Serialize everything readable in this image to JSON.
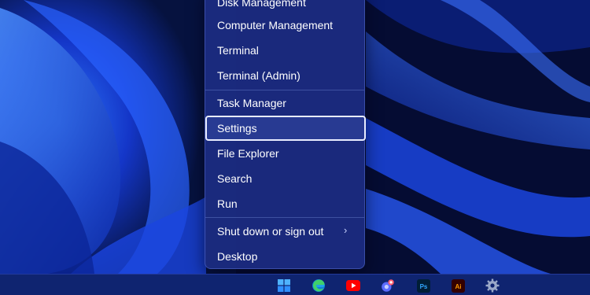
{
  "context_menu": {
    "items": [
      {
        "label": "Disk Management"
      },
      {
        "label": "Computer Management"
      },
      {
        "label": "Terminal"
      },
      {
        "label": "Terminal (Admin)"
      },
      {
        "label": "Task Manager"
      },
      {
        "label": "Settings",
        "focused": true
      },
      {
        "label": "File Explorer"
      },
      {
        "label": "Search"
      },
      {
        "label": "Run"
      },
      {
        "label": "Shut down or sign out",
        "has_submenu": true
      },
      {
        "label": "Desktop"
      }
    ]
  },
  "taskbar": {
    "icons": [
      {
        "name": "windows-start-icon"
      },
      {
        "name": "edge-browser-icon"
      },
      {
        "name": "youtube-icon"
      },
      {
        "name": "chat-app-icon"
      },
      {
        "name": "photoshop-icon",
        "text": "Ps"
      },
      {
        "name": "illustrator-icon",
        "text": "Ai"
      },
      {
        "name": "settings-gear-icon"
      }
    ]
  },
  "colors": {
    "menu_bg": "#1c2c82",
    "taskbar_bg": "#0f2470",
    "accent_blue": "#1e5bff",
    "photoshop": "#31a8ff",
    "illustrator": "#ff9a00",
    "youtube_red": "#ff0000"
  }
}
